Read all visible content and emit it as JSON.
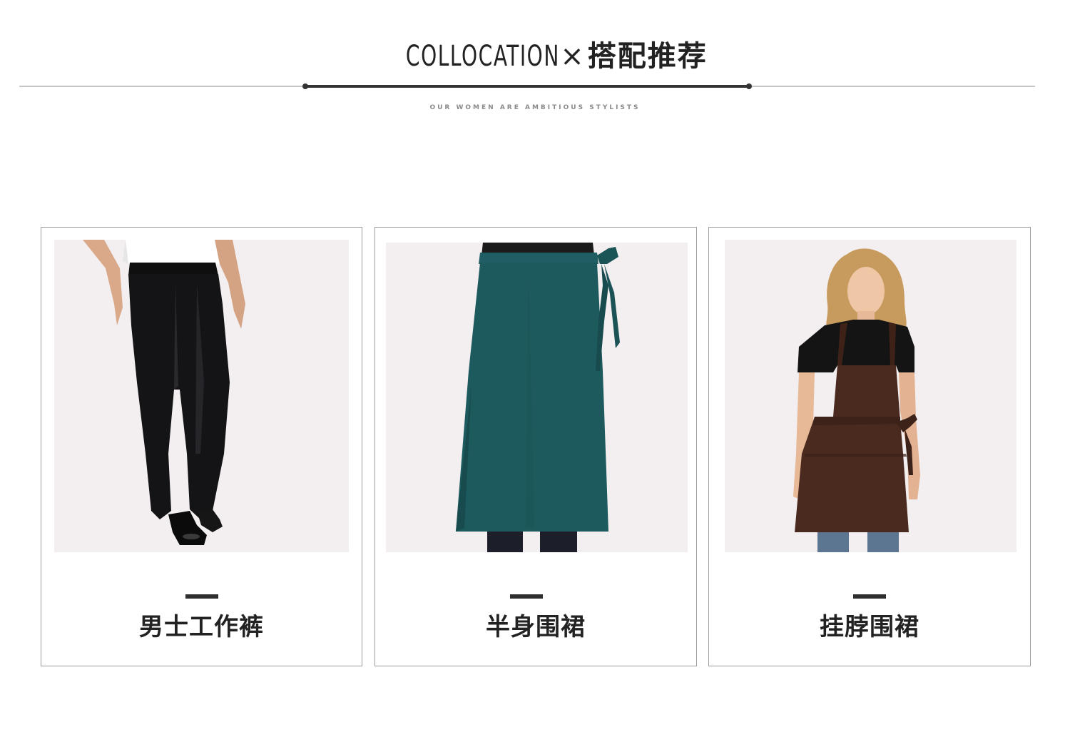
{
  "header": {
    "title_en": "COLLOCATION",
    "separator": "×",
    "title_zh": "搭配推荐",
    "subtitle": "OUR WOMEN ARE AMBITIOUS STYLISTS"
  },
  "products": [
    {
      "label": "男士工作裤",
      "image": "mens-work-pants-photo",
      "color": "#111111"
    },
    {
      "label": "半身围裙",
      "image": "half-apron-photo",
      "color": "#1d5a5e"
    },
    {
      "label": "挂脖围裙",
      "image": "bib-apron-photo",
      "color": "#4a2a1f"
    }
  ],
  "colors": {
    "photo_bg": "#f3eeef",
    "card_border": "#9c9c9c",
    "rule_thin": "#c8c8c8",
    "rule_thick": "#333333"
  }
}
